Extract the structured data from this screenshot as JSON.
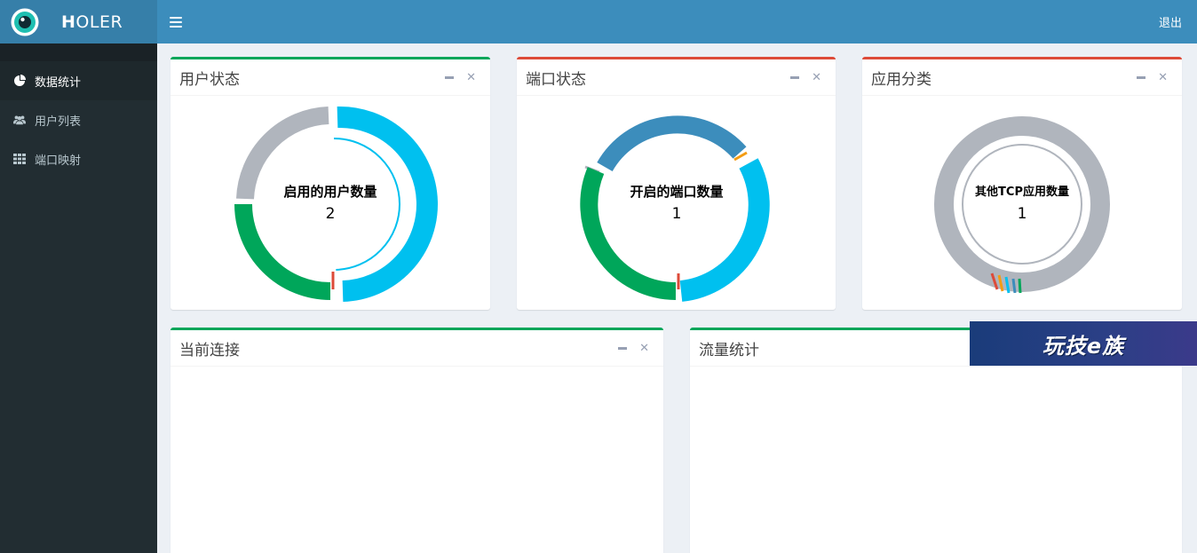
{
  "header": {
    "logo_bold": "H",
    "logo_rest": "OLER",
    "logout_label": "退出"
  },
  "sidebar": {
    "items": [
      {
        "label": "数据统计",
        "icon": "pie-chart-icon",
        "active": true
      },
      {
        "label": "用户列表",
        "icon": "users-icon",
        "active": false
      },
      {
        "label": "端口映射",
        "icon": "grid-icon",
        "active": false
      }
    ]
  },
  "boxes": {
    "user_status": {
      "title": "用户状态",
      "center_label": "启用的用户数量",
      "center_value": "2"
    },
    "port_status": {
      "title": "端口状态",
      "center_label": "开启的端口数量",
      "center_value": "1"
    },
    "app_category": {
      "title": "应用分类",
      "center_label": "其他TCP应用数量",
      "center_value": "1"
    },
    "current_connections": {
      "title": "当前连接"
    },
    "traffic_stats": {
      "title": "流量统计"
    }
  },
  "watermark_text": "玩技e族",
  "colors": {
    "header_bg": "#3c8dbc",
    "logo_bg": "#367fa9",
    "sidebar_bg": "#222d32",
    "green": "#00a65a",
    "red": "#dd4b39",
    "aqua": "#00c0ef",
    "blue": "#3c8dbc",
    "gray": "#b0b5bd"
  }
}
